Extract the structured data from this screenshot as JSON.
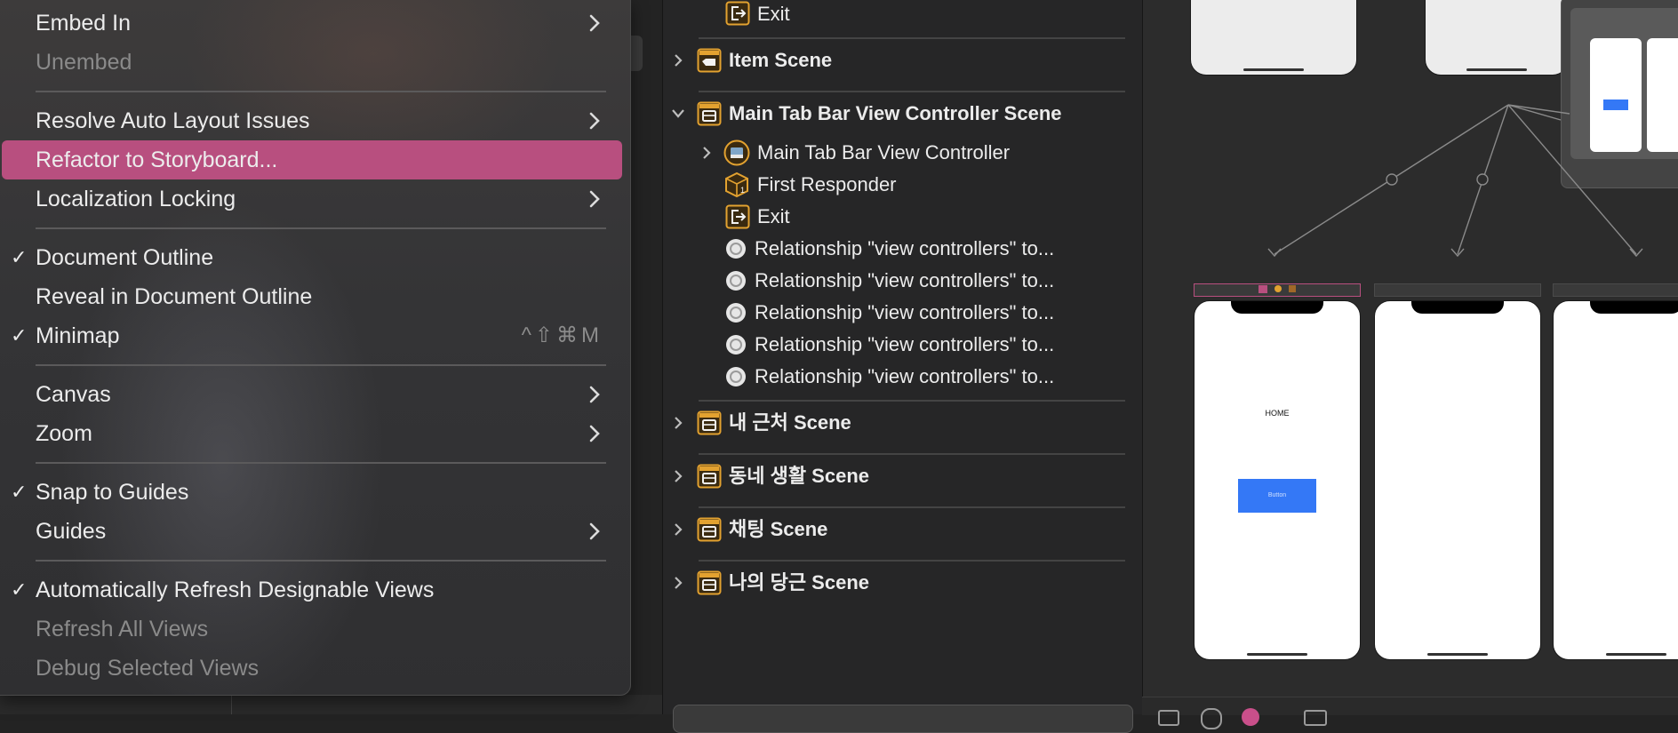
{
  "menu": {
    "items": [
      {
        "label": "Embed In",
        "submenu": true
      },
      {
        "label": "Unembed",
        "disabled": true
      },
      {
        "label": "Resolve Auto Layout Issues",
        "submenu": true
      },
      {
        "label": "Refactor to Storyboard...",
        "highlighted": true
      },
      {
        "label": "Localization Locking",
        "submenu": true
      },
      {
        "label": "Document Outline",
        "checked": true
      },
      {
        "label": "Reveal in Document Outline"
      },
      {
        "label": "Minimap",
        "checked": true,
        "shortcut": "^⇧⌘M"
      },
      {
        "label": "Canvas",
        "submenu": true
      },
      {
        "label": "Zoom",
        "submenu": true
      },
      {
        "label": "Snap to Guides",
        "checked": true
      },
      {
        "label": "Guides",
        "submenu": true
      },
      {
        "label": "Automatically Refresh Designable Views",
        "checked": true
      },
      {
        "label": "Refresh All Views",
        "disabled": true
      },
      {
        "label": "Debug Selected Views",
        "disabled": true
      }
    ],
    "check_glyph": "✓"
  },
  "outline": {
    "top_exit": "Exit",
    "scenes": [
      {
        "label": "Item Scene",
        "expanded": false
      },
      {
        "label": "Main Tab Bar View Controller Scene",
        "expanded": true
      },
      {
        "label": "내 근처 Scene",
        "expanded": false
      },
      {
        "label": "동네 생활 Scene",
        "expanded": false
      },
      {
        "label": "채팅 Scene",
        "expanded": false
      },
      {
        "label": "나의 당근 Scene",
        "expanded": false
      }
    ],
    "children": [
      {
        "label": "Main Tab Bar View Controller",
        "icon": "tab-bar-controller-icon",
        "expandable": true
      },
      {
        "label": "First Responder",
        "icon": "first-responder-icon"
      },
      {
        "label": "Exit",
        "icon": "exit-icon"
      },
      {
        "label": "Relationship \"view controllers\" to...",
        "icon": "relationship-icon"
      },
      {
        "label": "Relationship \"view controllers\" to...",
        "icon": "relationship-icon"
      },
      {
        "label": "Relationship \"view controllers\" to...",
        "icon": "relationship-icon"
      },
      {
        "label": "Relationship \"view controllers\" to...",
        "icon": "relationship-icon"
      },
      {
        "label": "Relationship \"view controllers\" to...",
        "icon": "relationship-icon"
      }
    ]
  },
  "canvas": {
    "home_label": "HOME",
    "button_label": "Button",
    "accent": "#3478f6"
  },
  "colors": {
    "highlight": "#b84f7f",
    "scene_icon": "#f0a826"
  }
}
